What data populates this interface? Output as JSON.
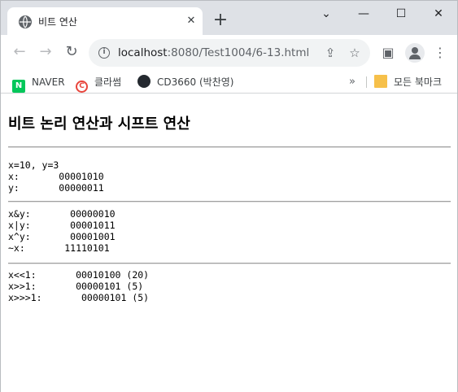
{
  "browser": {
    "tab_title": "비트 연산",
    "tab_close": "✕",
    "new_tab": "+",
    "window_controls": {
      "minimize": "—",
      "maximize": "☐",
      "close": "✕"
    },
    "nav": {
      "back": "←",
      "forward": "→",
      "reload": "↻"
    },
    "url_host": "localhost",
    "url_rest": ":8080/Test1004/6-13.html",
    "info_icon": "i",
    "bookmarks": [
      {
        "label": "NAVER",
        "icon": "N"
      },
      {
        "label": "클라썸",
        "icon": "C"
      },
      {
        "label": "CD3660 (박찬영)",
        "icon": ""
      }
    ],
    "bookmarks_more": "»",
    "all_bookmarks": "모든 북마크"
  },
  "page": {
    "heading": "비트 논리 연산과 시프트 연산",
    "section1": [
      "x=10, y=3",
      "x:       00001010",
      "y:       00000011"
    ],
    "section2": [
      "x&y:       00000010",
      "x|y:       00001011",
      "x^y:       00001001",
      "~x:       11110101"
    ],
    "section3": [
      "x<<1:       00010100 (20)",
      "x>>1:       00000101 (5)",
      "x>>>1:       00000101 (5)"
    ]
  }
}
